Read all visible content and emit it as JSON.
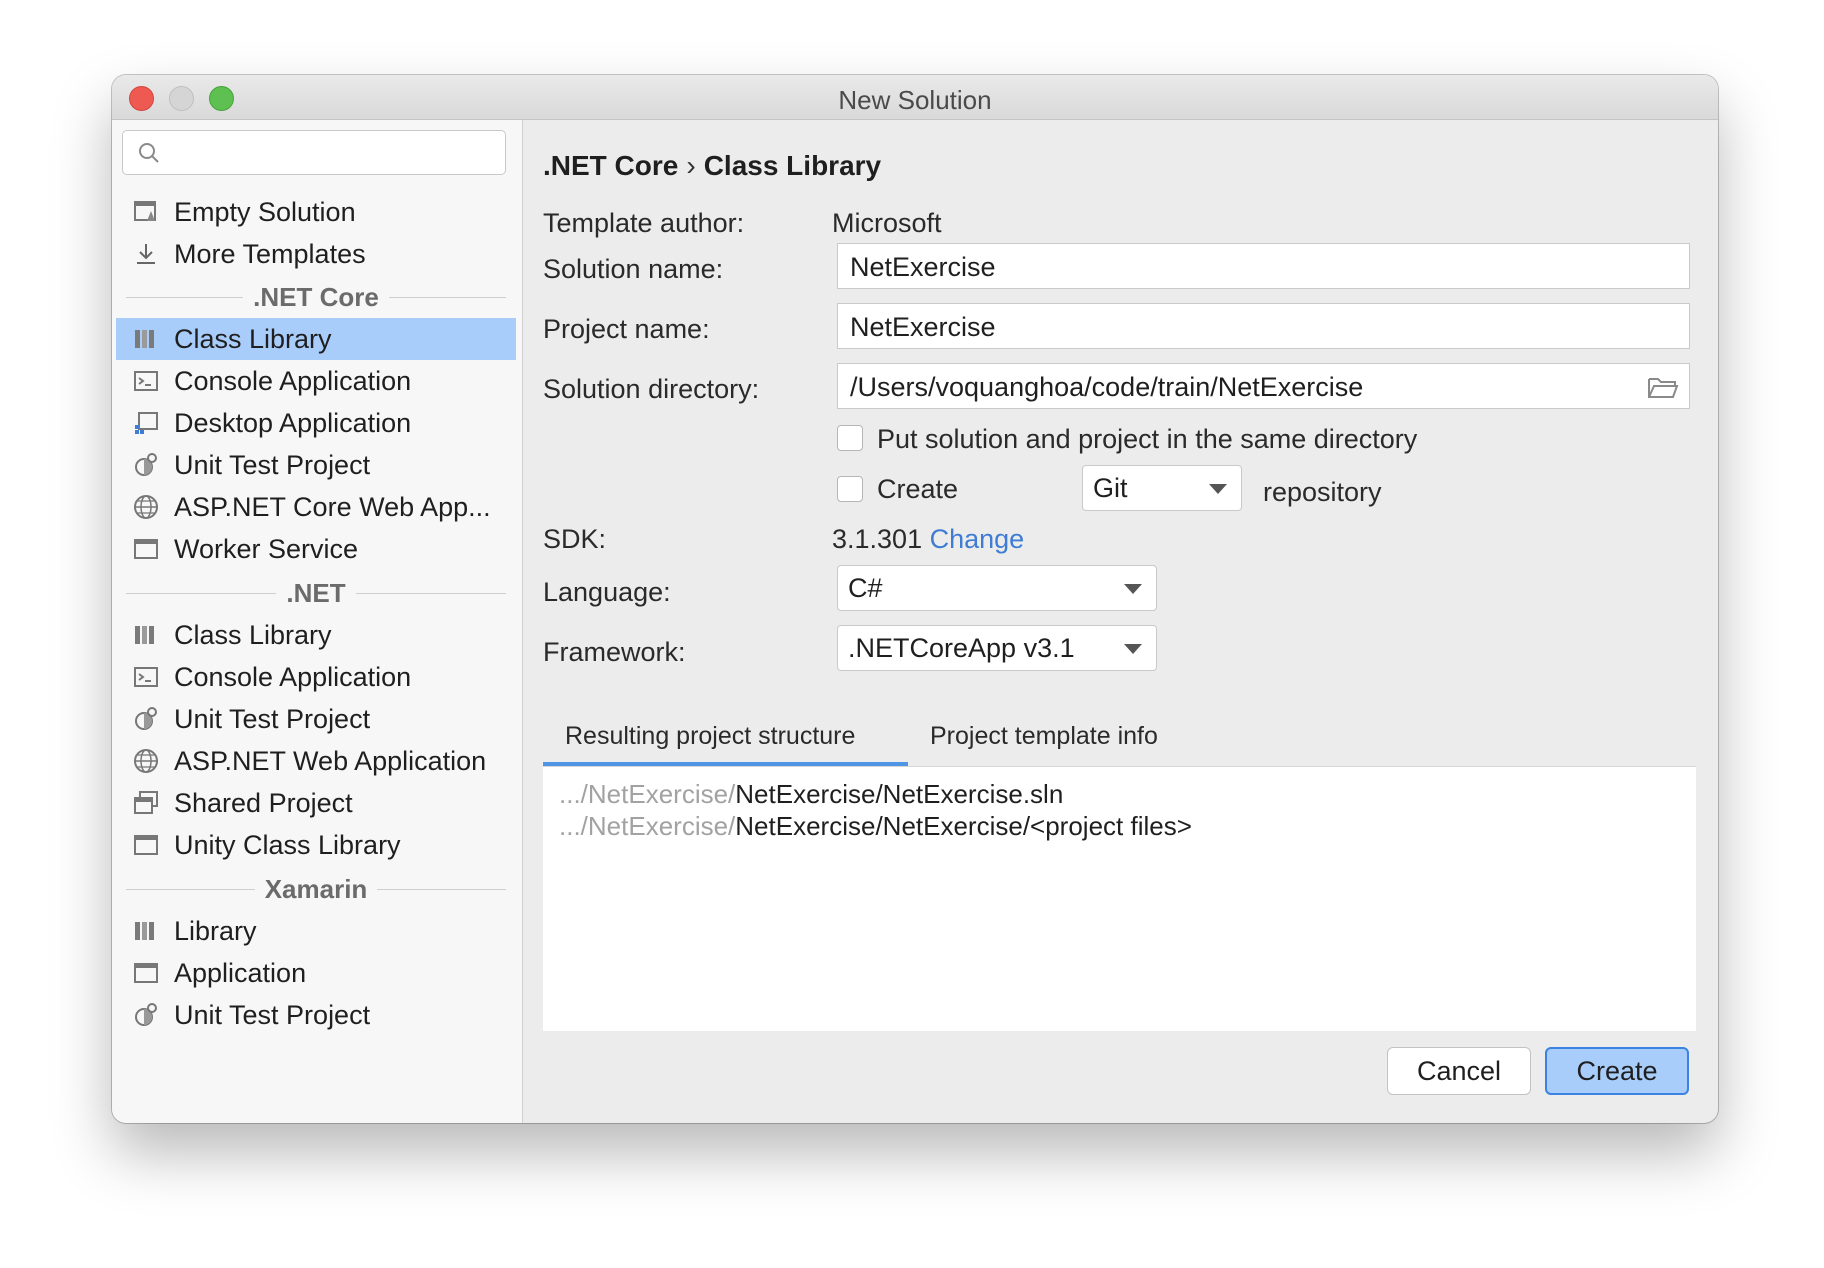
{
  "window": {
    "title": "New Solution"
  },
  "sidebar": {
    "search": {
      "value": "",
      "placeholder": ""
    },
    "top_items": [
      {
        "label": "Empty Solution",
        "icon": "empty-solution-icon"
      },
      {
        "label": "More Templates",
        "icon": "download-icon"
      }
    ],
    "groups": [
      {
        "title": ".NET Core",
        "items": [
          {
            "label": "Class Library",
            "icon": "library-icon",
            "selected": true
          },
          {
            "label": "Console Application",
            "icon": "console-icon"
          },
          {
            "label": "Desktop Application",
            "icon": "desktop-icon"
          },
          {
            "label": "Unit Test Project",
            "icon": "unit-test-icon"
          },
          {
            "label": "ASP.NET Core Web App...",
            "icon": "globe-icon"
          },
          {
            "label": "Worker Service",
            "icon": "window-icon"
          }
        ]
      },
      {
        "title": ".NET",
        "items": [
          {
            "label": "Class Library",
            "icon": "library-icon"
          },
          {
            "label": "Console Application",
            "icon": "console-icon"
          },
          {
            "label": "Unit Test Project",
            "icon": "unit-test-icon"
          },
          {
            "label": "ASP.NET Web Application",
            "icon": "globe-icon"
          },
          {
            "label": "Shared Project",
            "icon": "shared-icon"
          },
          {
            "label": "Unity Class Library",
            "icon": "window-icon"
          }
        ]
      },
      {
        "title": "Xamarin",
        "items": [
          {
            "label": "Library",
            "icon": "library-icon"
          },
          {
            "label": "Application",
            "icon": "window-icon"
          },
          {
            "label": "Unit Test Project",
            "icon": "unit-test-icon"
          }
        ]
      }
    ]
  },
  "main": {
    "breadcrumb": {
      "parent": ".NET Core",
      "separator": "›",
      "current": "Class Library"
    },
    "template_author": {
      "label": "Template author:",
      "value": "Microsoft"
    },
    "solution_name": {
      "label": "Solution name:",
      "value": "NetExercise"
    },
    "project_name": {
      "label": "Project name:",
      "value": "NetExercise"
    },
    "solution_directory": {
      "label": "Solution directory:",
      "value": "/Users/voquanghoa/code/train/NetExercise"
    },
    "same_directory": {
      "label": "Put solution and project in the same directory",
      "checked": false
    },
    "create_repo": {
      "label_before": "Create",
      "vcs": "Git",
      "label_after": "repository",
      "checked": false
    },
    "sdk": {
      "label": "SDK:",
      "value": "3.1.301",
      "link": "Change"
    },
    "language": {
      "label": "Language:",
      "value": "C#"
    },
    "framework": {
      "label": "Framework:",
      "value": ".NETCoreApp v3.1"
    },
    "tabs": [
      {
        "label": "Resulting project structure",
        "active": true
      },
      {
        "label": "Project template info",
        "active": false
      }
    ],
    "structure": [
      {
        "prefix": ".../NetExercise/",
        "path": "NetExercise/NetExercise.sln"
      },
      {
        "prefix": ".../NetExercise/",
        "path": "NetExercise/NetExercise/<project files>"
      }
    ],
    "buttons": {
      "cancel": "Cancel",
      "create": "Create"
    }
  },
  "colors": {
    "selection": "#a9cdfb",
    "accent": "#3a83e1",
    "link": "#3e7dd3",
    "close": "#ee5a52",
    "maximize": "#5dc050"
  }
}
